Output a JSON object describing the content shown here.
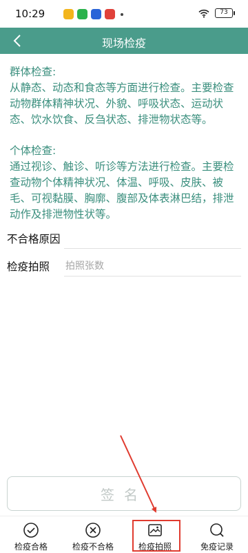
{
  "status_bar": {
    "time": "10:29",
    "battery": "73"
  },
  "header": {
    "title": "现场检疫"
  },
  "info_group": {
    "title": "群体检查:",
    "text": "从静态、动态和食态等方面进行检查。主要检查动物群体精神状况、外貌、呼吸状态、运动状态、饮水饮食、反刍状态、排泄物状态等。"
  },
  "info_individual": {
    "title": "个体检查:",
    "text": "通过视诊、触诊、听诊等方法进行检查。主要检查动物个体精神状况、体温、呼吸、皮肤、被毛、可视黏膜、胸廓、腹部及体表淋巴结，排泄动作及排泄物性状等。"
  },
  "form": {
    "reason_label": "不合格原因",
    "reason_value": "",
    "photo_label": "检疫拍照",
    "photo_placeholder": "拍照张数"
  },
  "sign_button": {
    "label": "签名"
  },
  "bottom_bar": {
    "tabs": [
      {
        "label": "检疫合格",
        "icon": "check-circle-icon"
      },
      {
        "label": "检疫不合格",
        "icon": "x-circle-icon"
      },
      {
        "label": "检疫拍照",
        "icon": "photo-icon"
      },
      {
        "label": "免疫记录",
        "icon": "search-icon"
      }
    ]
  },
  "colors": {
    "header_bg": "#4a9c8b",
    "info_text": "#3b8f7e",
    "annotation": "#e03b2f"
  }
}
